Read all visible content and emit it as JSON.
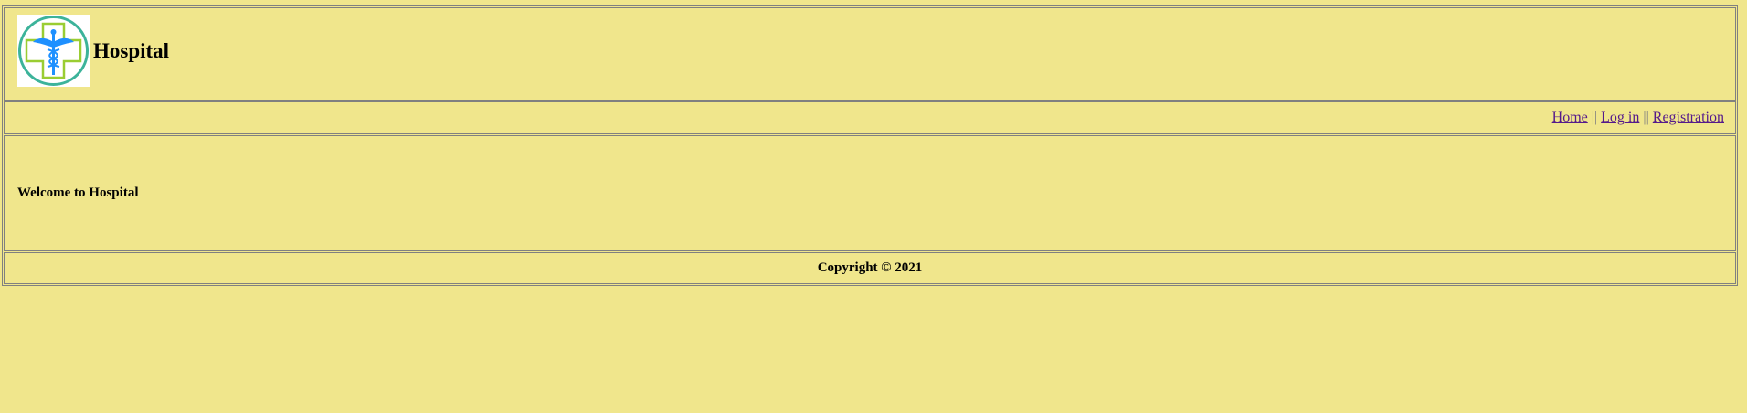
{
  "header": {
    "logo_icon": "medical-cross-caduceus-icon",
    "title": "Hospital"
  },
  "nav": {
    "links": [
      "Home",
      "Log in",
      "Registration"
    ],
    "separator": "||"
  },
  "main": {
    "welcome": "Welcome to Hospital"
  },
  "footer": {
    "copyright": "Copyright © 2021"
  },
  "colors": {
    "background": "#f0e68c",
    "border": "#808080",
    "link": "#551a8b",
    "logo_cross": "#9acd32",
    "logo_ring": "#3cb39a",
    "logo_caduceus": "#1e90ff"
  }
}
